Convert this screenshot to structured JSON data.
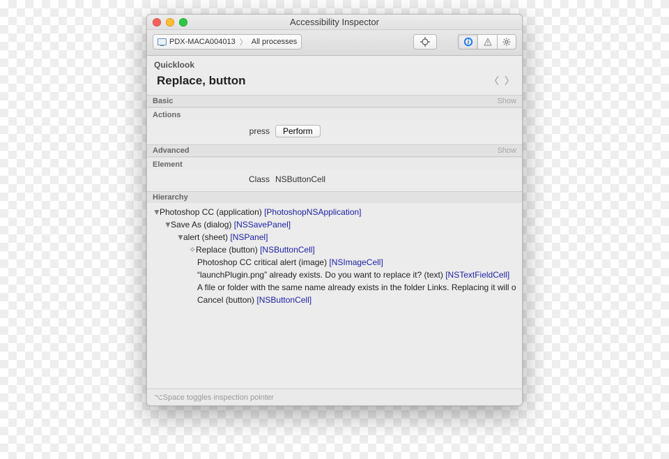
{
  "window": {
    "title": "Accessibility Inspector"
  },
  "toolbar": {
    "device": "PDX-MACA004013",
    "scope": "All processes"
  },
  "quicklook": {
    "label": "Quicklook",
    "heading": "Replace, button"
  },
  "sections": {
    "basic": {
      "title": "Basic",
      "show": "Show"
    },
    "actions": {
      "title": "Actions",
      "action_name": "press",
      "perform_label": "Perform"
    },
    "advanced": {
      "title": "Advanced",
      "show": "Show"
    },
    "element": {
      "title": "Element",
      "class_label": "Class",
      "class_value": "NSButtonCell"
    },
    "hierarchy": {
      "title": "Hierarchy"
    }
  },
  "hierarchy": {
    "items": [
      {
        "indent": 0,
        "marker": "▼",
        "label": "Photoshop CC (application)",
        "class": "[PhotoshopNSApplication]"
      },
      {
        "indent": 1,
        "marker": "▼",
        "label": "Save As (dialog)",
        "class": "[NSSavePanel]"
      },
      {
        "indent": 2,
        "marker": "▼",
        "label": "alert (sheet)",
        "class": "[NSPanel]"
      },
      {
        "indent": 3,
        "marker": "✧",
        "label": "Replace (button)",
        "class": "[NSButtonCell]"
      },
      {
        "indent": 3,
        "marker": "",
        "label": "Photoshop CC critical alert (image)",
        "class": "[NSImageCell]"
      },
      {
        "indent": 3,
        "marker": "",
        "label": "“launchPlugin.png” already exists. Do you want to replace it? (text)",
        "class": "[NSTextFieldCell]"
      },
      {
        "indent": 3,
        "marker": "",
        "label": "A file or folder with the same name already exists in the folder Links. Replacing it will ove",
        "class": ""
      },
      {
        "indent": 3,
        "marker": "",
        "label": "Cancel (button)",
        "class": "[NSButtonCell]"
      }
    ]
  },
  "statusbar": {
    "hint": "⌥Space toggles inspection pointer"
  }
}
